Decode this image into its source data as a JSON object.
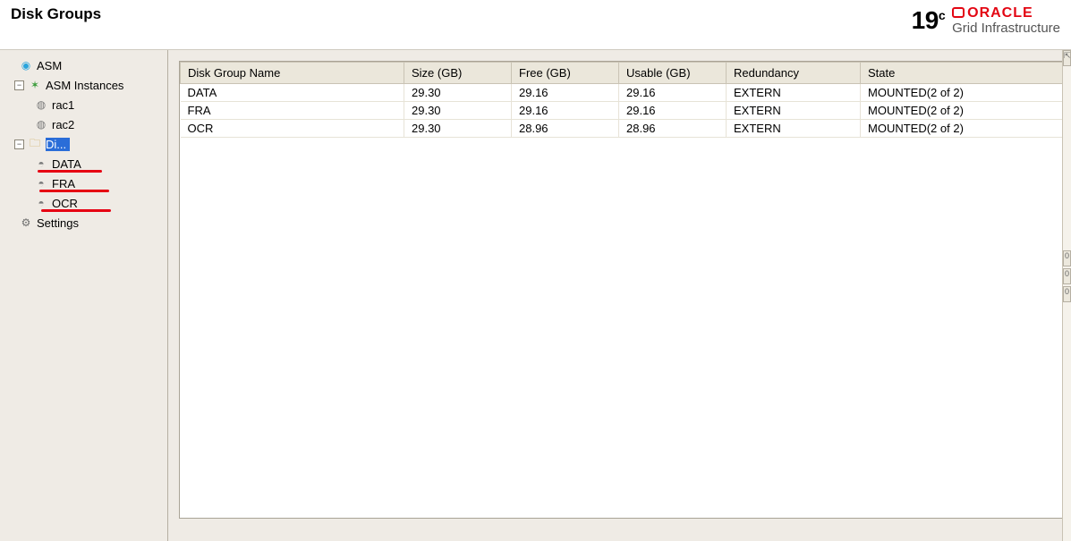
{
  "header": {
    "title": "Disk Groups",
    "brand_version": "19",
    "brand_suffix": "c",
    "brand_name_upper": "ORACLE",
    "brand_subtitle": "Grid Infrastructure"
  },
  "sidebar": {
    "root": {
      "label": "ASM"
    },
    "instances": {
      "label": "ASM Instances",
      "items": [
        {
          "label": "rac1"
        },
        {
          "label": "rac2"
        }
      ]
    },
    "diskgroups": {
      "label": "Di...",
      "items": [
        {
          "label": "DATA"
        },
        {
          "label": "FRA"
        },
        {
          "label": "OCR"
        }
      ]
    },
    "settings": {
      "label": "Settings"
    }
  },
  "table": {
    "columns": [
      "Disk Group Name",
      "Size (GB)",
      "Free (GB)",
      "Usable (GB)",
      "Redundancy",
      "State"
    ],
    "rows": [
      {
        "name": "DATA",
        "size": "29.30",
        "free": "29.16",
        "usable": "29.16",
        "redundancy": "EXTERN",
        "state": "MOUNTED(2 of 2)"
      },
      {
        "name": "FRA",
        "size": "29.30",
        "free": "29.16",
        "usable": "29.16",
        "redundancy": "EXTERN",
        "state": "MOUNTED(2 of 2)"
      },
      {
        "name": "OCR",
        "size": "29.30",
        "free": "28.96",
        "usable": "28.96",
        "redundancy": "EXTERN",
        "state": "MOUNTED(2 of 2)"
      }
    ]
  },
  "right_rail": {
    "top_glyph": "⇱",
    "nub_values": [
      "0",
      "0",
      "0"
    ]
  }
}
